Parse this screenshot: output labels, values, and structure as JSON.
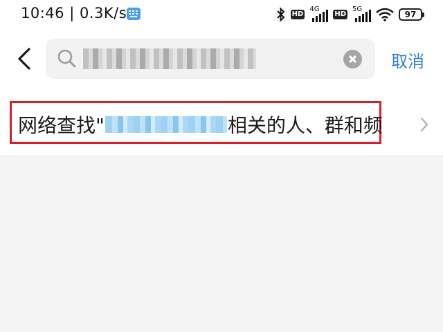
{
  "status_bar": {
    "time_speed": "10:46 | 0.3K/s",
    "hd_badge": "HD",
    "sim1_gen": "4G",
    "sim2_gen": "5G",
    "battery": "97",
    "icons": [
      "keyboard-icon",
      "bluetooth-icon",
      "wifi-icon",
      "battery-icon"
    ]
  },
  "search": {
    "query": "",
    "clear_icon": "close-circle-icon",
    "search_icon": "search-icon",
    "cancel_label": "取消"
  },
  "result_row": {
    "prefix": "网络查找\"",
    "suffix": "相关的人、群和频",
    "highlight_color": "#d91e2a"
  },
  "colors": {
    "accent": "#2f7fd8",
    "background": "#f3f3f3"
  }
}
